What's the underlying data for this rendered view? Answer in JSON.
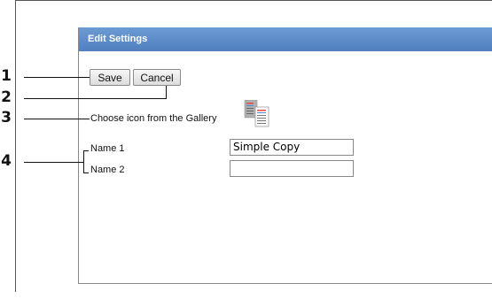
{
  "dialog": {
    "title": "Edit Settings",
    "buttons": {
      "save_label": "Save",
      "cancel_label": "Cancel"
    },
    "gallery_label": "Choose icon from the Gallery",
    "gallery_icon": "copy-documents-icon",
    "name1": {
      "label": "Name 1",
      "value": "Simple Copy"
    },
    "name2": {
      "label": "Name 2",
      "value": ""
    }
  },
  "callouts": [
    "1",
    "2",
    "3",
    "4"
  ],
  "colors": {
    "title_bar": "#5a8ac8",
    "title_text": "#ffffff"
  }
}
